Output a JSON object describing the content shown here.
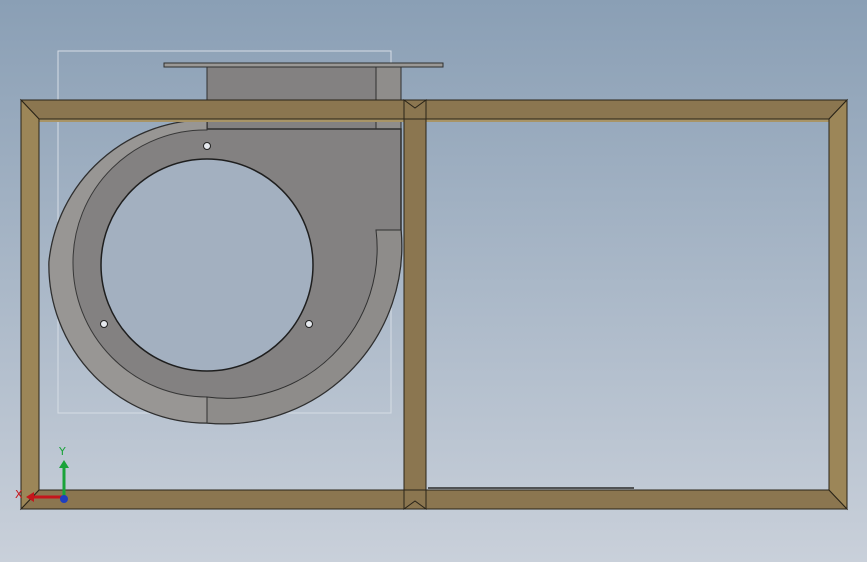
{
  "viewport": {
    "background_top": "#8a9fb5",
    "background_bottom": "#c9d0da",
    "frame_color": "#8b7650",
    "frame_inner_color": "#a89466",
    "housing_color": "#838181",
    "housing_edge_color": "#2f2f2f",
    "flange_color": "#9a9896"
  },
  "triad": {
    "x_label": "X",
    "y_label": "Y",
    "x_color": "#c4161c",
    "y_color": "#1aa33a",
    "z_color": "#1f3fbf"
  }
}
